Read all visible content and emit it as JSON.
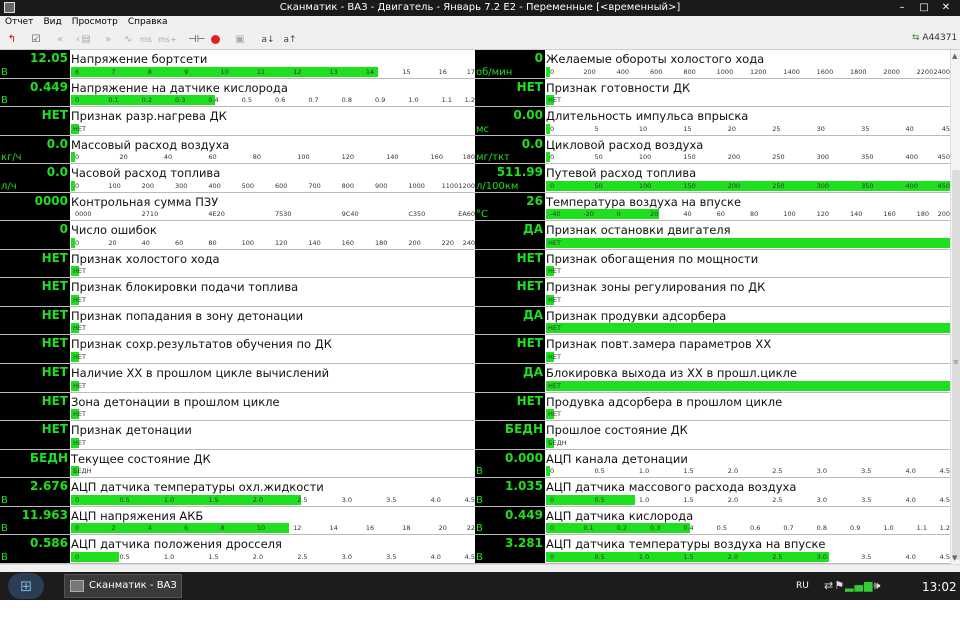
{
  "window": {
    "title": "Сканматик - ВАЗ - Двигатель - Январь 7.2 Е2 - Переменные [<временный>]",
    "btn_min": "–",
    "btn_max": "□",
    "btn_close": "✕"
  },
  "menu": [
    "Отчет",
    "Вид",
    "Просмотр",
    "Справка"
  ],
  "toolbar": {
    "icons": [
      "exit-icon",
      "report-icon",
      "back-icon",
      "back-step-icon",
      "list-icon",
      "forward-icon",
      "graph-icon",
      "ms-icon",
      "ms-plus-icon",
      "probe-icon",
      "record-icon",
      "chart-icon",
      "sort-asc-icon",
      "sort-font-icon"
    ],
    "ms_label": "ms",
    "ms_plus_label": "ms+",
    "sort_a_label": "a↓",
    "sort_b_label": "a↑",
    "connection_id": "A44371",
    "accent": "#1ee01e",
    "record_color": "#e02020"
  },
  "params_left": [
    {
      "value": "12.05",
      "unit": "В",
      "name": "Напряжение бортсети",
      "fill": 0.76,
      "ticks": [
        "6",
        "7",
        "8",
        "9",
        "10",
        "11",
        "12",
        "13",
        "14",
        "15",
        "16",
        "17"
      ]
    },
    {
      "value": "0.449",
      "unit": "В",
      "name": "Напряжение на датчике кислорода",
      "fill": 0.357,
      "ticks": [
        "0",
        "0.1",
        "0.2",
        "0.3",
        "0.4",
        "0.5",
        "0.6",
        "0.7",
        "0.8",
        "0.9",
        "1.0",
        "1.1",
        "1.2"
      ]
    },
    {
      "value": "НЕТ",
      "unit": "",
      "name": "Признак разр.нагрева ДК",
      "fill": 0.02,
      "ticks": [
        "НЕТ"
      ]
    },
    {
      "value": "0.0",
      "unit": "кг/ч",
      "name": "Массовый расход воздуха",
      "fill": 0.01,
      "ticks": [
        "0",
        "20",
        "40",
        "60",
        "80",
        "100",
        "120",
        "140",
        "160",
        "180"
      ]
    },
    {
      "value": "0.0",
      "unit": "л/ч",
      "name": "Часовой расход топлива",
      "fill": 0.01,
      "ticks": [
        "0",
        "100",
        "200",
        "300",
        "400",
        "500",
        "600",
        "700",
        "800",
        "900",
        "1000",
        "1100",
        "1200"
      ]
    },
    {
      "value": "0000",
      "unit": "",
      "name": "Контрольная сумма ПЗУ",
      "fill": 0,
      "ticks": [
        "0000",
        "2710",
        "4E20",
        "7530",
        "9C40",
        "C350",
        "EA60"
      ]
    },
    {
      "value": "0",
      "unit": "",
      "name": "Число ошибок",
      "fill": 0.01,
      "ticks": [
        "0",
        "20",
        "40",
        "60",
        "80",
        "100",
        "120",
        "140",
        "160",
        "180",
        "200",
        "220",
        "240"
      ]
    },
    {
      "value": "НЕТ",
      "unit": "",
      "name": "Признак холостого хода",
      "fill": 0.02,
      "ticks": [
        "НЕТ"
      ]
    },
    {
      "value": "НЕТ",
      "unit": "",
      "name": "Признак блокировки подачи топлива",
      "fill": 0.02,
      "ticks": [
        "НЕТ"
      ]
    },
    {
      "value": "НЕТ",
      "unit": "",
      "name": "Признак попадания в зону детонации",
      "fill": 0.02,
      "ticks": [
        "НЕТ"
      ]
    },
    {
      "value": "НЕТ",
      "unit": "",
      "name": "Признак сохр.результатов обучения по ДК",
      "fill": 0.02,
      "ticks": [
        "НЕТ"
      ]
    },
    {
      "value": "НЕТ",
      "unit": "",
      "name": "Наличие ХХ в прошлом цикле вычислений",
      "fill": 0.02,
      "ticks": [
        "НЕТ"
      ]
    },
    {
      "value": "НЕТ",
      "unit": "",
      "name": "Зона детонации в прошлом цикле",
      "fill": 0.02,
      "ticks": [
        "НЕТ"
      ]
    },
    {
      "value": "НЕТ",
      "unit": "",
      "name": "Признак детонации",
      "fill": 0.02,
      "ticks": [
        "НЕТ"
      ]
    },
    {
      "value": "БЕДН",
      "unit": "",
      "name": "Текущее состояние ДК",
      "fill": 0.02,
      "ticks": [
        "БЕДН"
      ]
    },
    {
      "value": "2.676",
      "unit": "В",
      "name": "АЦП датчика температуры охл.жидкости",
      "fill": 0.57,
      "ticks": [
        "0",
        "0.5",
        "1.0",
        "1.5",
        "2.0",
        "2.5",
        "3.0",
        "3.5",
        "4.0",
        "4.5"
      ]
    },
    {
      "value": "11.963",
      "unit": "В",
      "name": "АЦП напряжения АКБ",
      "fill": 0.54,
      "ticks": [
        "0",
        "2",
        "4",
        "6",
        "8",
        "10",
        "12",
        "14",
        "16",
        "18",
        "20",
        "22"
      ]
    },
    {
      "value": "0.586",
      "unit": "В",
      "name": "АЦП датчика положения дросселя",
      "fill": 0.12,
      "ticks": [
        "0",
        "0.5",
        "1.0",
        "1.5",
        "2.0",
        "2.5",
        "3.0",
        "3.5",
        "4.0",
        "4.5"
      ]
    }
  ],
  "params_right": [
    {
      "value": "0",
      "unit": "об/мин",
      "name": "Желаемые обороты холостого хода",
      "fill": 0.01,
      "ticks": [
        "0",
        "200",
        "400",
        "600",
        "800",
        "1000",
        "1200",
        "1400",
        "1600",
        "1800",
        "2000",
        "2200",
        "2400"
      ]
    },
    {
      "value": "НЕТ",
      "unit": "",
      "name": "Признак готовности ДК",
      "fill": 0.02,
      "ticks": [
        "НЕТ"
      ]
    },
    {
      "value": "0.00",
      "unit": "мс",
      "name": "Длительность импульса впрыска",
      "fill": 0.01,
      "ticks": [
        "0",
        "5",
        "10",
        "15",
        "20",
        "25",
        "30",
        "35",
        "40",
        "45"
      ]
    },
    {
      "value": "0.0",
      "unit": "мг/ткт",
      "name": "Цикловой расход воздуха",
      "fill": 0.01,
      "ticks": [
        "0",
        "50",
        "100",
        "150",
        "200",
        "250",
        "300",
        "350",
        "400",
        "450"
      ]
    },
    {
      "value": "511.99",
      "unit": "л/100км",
      "name": "Путевой расход топлива",
      "fill": 1.0,
      "ticks": [
        "0",
        "50",
        "100",
        "150",
        "200",
        "250",
        "300",
        "350",
        "400",
        "450"
      ]
    },
    {
      "value": "26",
      "unit": "°C",
      "name": "Температура воздуха на впуске",
      "fill": 0.28,
      "ticks": [
        "-40",
        "-20",
        "0",
        "20",
        "40",
        "60",
        "80",
        "100",
        "120",
        "140",
        "160",
        "180",
        "200"
      ]
    },
    {
      "value": "ДА",
      "unit": "",
      "name": "Признак остановки двигателя",
      "fill": 1.0,
      "ticks": [
        "НЕТ"
      ]
    },
    {
      "value": "НЕТ",
      "unit": "",
      "name": "Признак обогащения по мощности",
      "fill": 0.02,
      "ticks": [
        "НЕТ"
      ]
    },
    {
      "value": "НЕТ",
      "unit": "",
      "name": "Признак зоны регулирования по ДК",
      "fill": 0.02,
      "ticks": [
        "НЕТ"
      ]
    },
    {
      "value": "ДА",
      "unit": "",
      "name": "Признак продувки адсорбера",
      "fill": 1.0,
      "ticks": [
        "НЕТ"
      ]
    },
    {
      "value": "НЕТ",
      "unit": "",
      "name": "Признак повт.замера параметров ХХ",
      "fill": 0.02,
      "ticks": [
        "НЕТ"
      ]
    },
    {
      "value": "ДА",
      "unit": "",
      "name": "Блокировка выхода из ХХ в прошл.цикле",
      "fill": 1.0,
      "ticks": [
        "НЕТ"
      ]
    },
    {
      "value": "НЕТ",
      "unit": "",
      "name": "Продувка адсорбера в прошлом цикле",
      "fill": 0.02,
      "ticks": [
        "НЕТ"
      ]
    },
    {
      "value": "БЕДН",
      "unit": "",
      "name": "Прошлое состояние ДК",
      "fill": 0.02,
      "ticks": [
        "БЕДН"
      ]
    },
    {
      "value": "0.000",
      "unit": "В",
      "name": "АЦП канала детонации",
      "fill": 0.01,
      "ticks": [
        "0",
        "0.5",
        "1.0",
        "1.5",
        "2.0",
        "2.5",
        "3.0",
        "3.5",
        "4.0",
        "4.5"
      ]
    },
    {
      "value": "1.035",
      "unit": "В",
      "name": "АЦП датчика массового расхода воздуха",
      "fill": 0.22,
      "ticks": [
        "0",
        "0.5",
        "1.0",
        "1.5",
        "2.0",
        "2.5",
        "3.0",
        "3.5",
        "4.0",
        "4.5"
      ]
    },
    {
      "value": "0.449",
      "unit": "В",
      "name": "АЦП датчика кислорода",
      "fill": 0.357,
      "ticks": [
        "0",
        "0.1",
        "0.2",
        "0.3",
        "0.4",
        "0.5",
        "0.6",
        "0.7",
        "0.8",
        "0.9",
        "1.0",
        "1.1",
        "1.2"
      ]
    },
    {
      "value": "3.281",
      "unit": "В",
      "name": "АЦП датчика температуры воздуха на впуске",
      "fill": 0.7,
      "ticks": [
        "0",
        "0.5",
        "1.0",
        "1.5",
        "2.0",
        "2.5",
        "3.0",
        "3.5",
        "4.0",
        "4.5"
      ]
    }
  ],
  "taskbar": {
    "task_label": "Сканматик - ВАЗ -...",
    "lang": "RU",
    "clock": "13:02"
  }
}
